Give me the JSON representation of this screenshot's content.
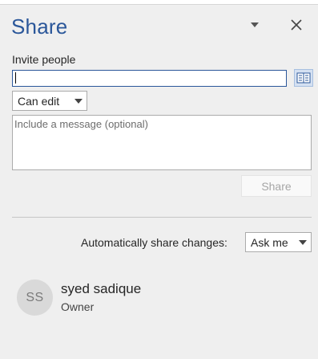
{
  "pane": {
    "title": "Share"
  },
  "invite": {
    "label": "Invite people",
    "value": "",
    "permission": "Can edit"
  },
  "message": {
    "placeholder": "Include a message (optional)"
  },
  "share_button": {
    "label": "Share"
  },
  "auto_share": {
    "label": "Automatically share changes:",
    "value": "Ask me"
  },
  "people": [
    {
      "initials": "SS",
      "name": "syed sadique",
      "role": "Owner"
    }
  ],
  "colors": {
    "accent": "#2b579a",
    "background": "#efefef"
  },
  "icons": {
    "options": "chevron-down-icon",
    "close": "close-icon",
    "address_book": "address-book-icon"
  }
}
